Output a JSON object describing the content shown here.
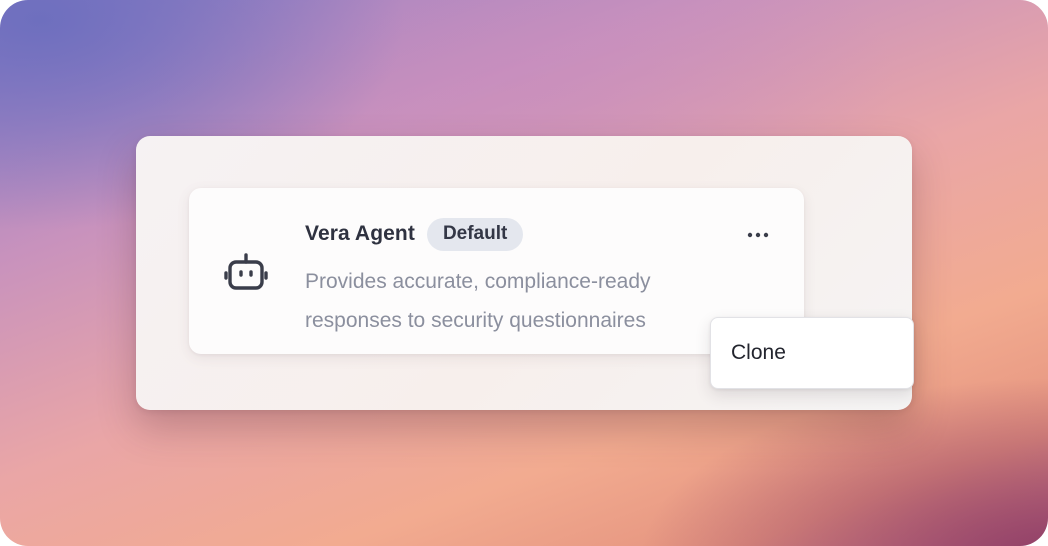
{
  "agent": {
    "name": "Vera Agent",
    "badge": "Default",
    "description_line1": "Provides accurate, compliance-ready",
    "description_line2": "responses to security questionnaires",
    "icon": "robot-icon"
  },
  "actions": {
    "more_icon": "more-horizontal-icon"
  },
  "menu": {
    "items": [
      {
        "label": "Clone"
      }
    ]
  },
  "colors": {
    "text_primary": "#2f3240",
    "text_muted": "#8b8f9e",
    "badge_bg": "#e4e7ee"
  }
}
